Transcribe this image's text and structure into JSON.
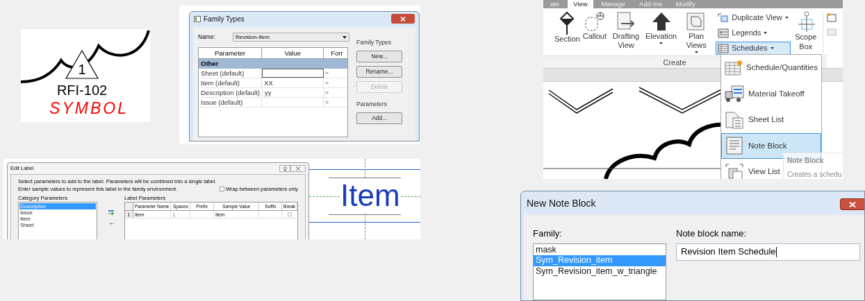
{
  "symbol": {
    "number": "1",
    "label": "RFI-102",
    "caption": "SYMBOL"
  },
  "family_types": {
    "title": "Family Types",
    "name_label": "Name:",
    "name_value": "Revision-Item",
    "columns": [
      "Parameter",
      "Value",
      "Forr"
    ],
    "group": "Other",
    "rows": [
      {
        "parameter": "Sheet (default)",
        "formula": "=",
        "selected": true
      },
      {
        "parameter": "Item (default)",
        "value": "XX",
        "formula": "=",
        "selected": false
      },
      {
        "parameter": "Description (default)",
        "value": "yy",
        "formula": "=",
        "selected": false
      },
      {
        "parameter": "Issue (default)",
        "formula": "=",
        "selected": false
      }
    ],
    "button_groups": [
      {
        "title": "Family Types",
        "buttons": [
          {
            "label": "New...",
            "disabled": false
          },
          {
            "label": "Rename...",
            "disabled": false
          },
          {
            "label": "Delete",
            "disabled": true
          }
        ]
      },
      {
        "title": "Parameters",
        "buttons": [
          {
            "label": "Add...",
            "disabled": false
          }
        ]
      }
    ]
  },
  "edit_label": {
    "title": "Edit Label",
    "instructions": [
      "Select parameters to add to the label.  Parameters will be combined into a single label.",
      "Enter sample values to represent this label in the family environment."
    ],
    "wrap_option": {
      "label": "Wrap between parameters only",
      "checked": false
    },
    "category_parameters": {
      "title": "Category Parameters",
      "items": [
        {
          "label": "Description",
          "selected": true
        },
        {
          "label": "Issue",
          "selected": false
        },
        {
          "label": "Item",
          "selected": false
        },
        {
          "label": "Sheet",
          "selected": false
        }
      ]
    },
    "label_parameters": {
      "title": "Label Parameters",
      "columns": [
        "Parameter Name",
        "Spaces",
        "Prefix",
        "Sample Value",
        "Suffix",
        "Break"
      ],
      "rows": [
        {
          "number": "1",
          "parameter_name": "Item",
          "spaces": "1",
          "sample_value": "Item",
          "break": false
        }
      ]
    }
  },
  "label_preview": {
    "text": "Item"
  },
  "ribbon": {
    "tabs": [
      {
        "label": "ate",
        "selected": false
      },
      {
        "label": "View",
        "selected": true
      },
      {
        "label": "Manage",
        "selected": false
      },
      {
        "label": "Add-Ins",
        "selected": false
      },
      {
        "label": "Modify",
        "selected": false
      }
    ],
    "large_buttons": [
      {
        "kind": "section",
        "label": "Section",
        "dropdown": false
      },
      {
        "kind": "callout",
        "label": "Callout",
        "dropdown": false
      },
      {
        "kind": "drafting",
        "label": "Drafting View",
        "dropdown": false
      },
      {
        "kind": "elevation",
        "label": "Elevation",
        "dropdown": true
      },
      {
        "kind": "plan",
        "label": "Plan Views",
        "dropdown": true
      }
    ],
    "small_buttons": [
      {
        "kind": "duplicate",
        "label": "Duplicate View",
        "selected": false
      },
      {
        "kind": "legends",
        "label": "Legends",
        "selected": false
      },
      {
        "kind": "schedules",
        "label": "Schedules",
        "selected": true
      }
    ],
    "scope_box": {
      "label": "Scope Box"
    },
    "panel_label": "Create",
    "menu": [
      {
        "kind": "schedule",
        "label": "Schedule/Quantities",
        "selected": false
      },
      {
        "kind": "takeoff",
        "label": "Material Takeoff",
        "selected": false
      },
      {
        "kind": "sheet",
        "label": "Sheet List",
        "selected": false
      },
      {
        "kind": "note",
        "label": "Note Block",
        "selected": true
      },
      {
        "kind": "view",
        "label": "View List",
        "selected": false
      }
    ],
    "tooltip": {
      "title": "Note Block",
      "description": "Creates a schedu"
    }
  },
  "new_note_block": {
    "title": "New Note Block",
    "family_label": "Family:",
    "families": [
      {
        "label": "mask",
        "selected": false
      },
      {
        "label": "Sym_Revision_item",
        "selected": true
      },
      {
        "label": "Sym_Revision_item_w_triangle",
        "selected": false
      }
    ],
    "name_label": "Note block name:",
    "name_value": "Revision Item Schedule"
  }
}
